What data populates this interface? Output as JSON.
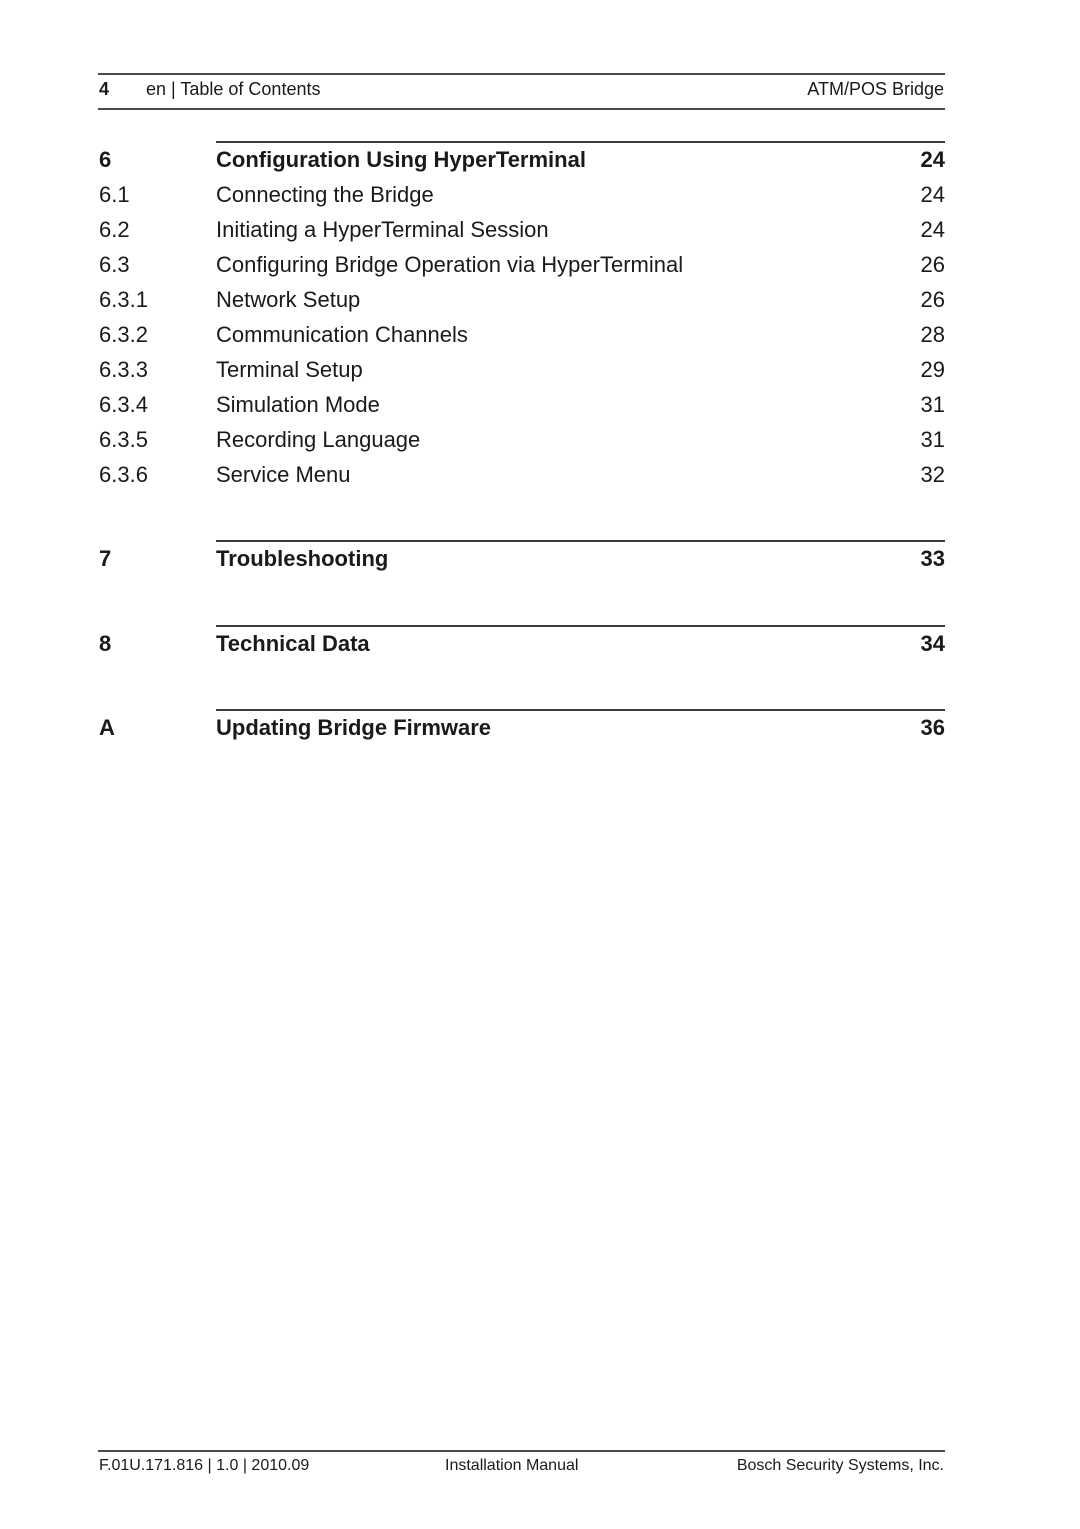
{
  "header": {
    "page_number": "4",
    "section_label": "en | Table of Contents",
    "product_name": "ATM/POS Bridge"
  },
  "toc": {
    "entries": [
      {
        "number": "6",
        "title": "Configuration Using HyperTerminal",
        "page": "24",
        "level": "chapter"
      },
      {
        "number": "6.1",
        "title": "Connecting the Bridge",
        "page": "24",
        "level": "section"
      },
      {
        "number": "6.2",
        "title": "Initiating a HyperTerminal Session",
        "page": "24",
        "level": "section"
      },
      {
        "number": "6.3",
        "title": "Configuring Bridge Operation via HyperTerminal",
        "page": "26",
        "level": "section"
      },
      {
        "number": "6.3.1",
        "title": "Network Setup",
        "page": "26",
        "level": "subsection"
      },
      {
        "number": "6.3.2",
        "title": "Communication Channels",
        "page": "28",
        "level": "subsection"
      },
      {
        "number": "6.3.3",
        "title": "Terminal Setup",
        "page": "29",
        "level": "subsection"
      },
      {
        "number": "6.3.4",
        "title": "Simulation Mode",
        "page": "31",
        "level": "subsection"
      },
      {
        "number": "6.3.5",
        "title": "Recording Language",
        "page": "31",
        "level": "subsection"
      },
      {
        "number": "6.3.6",
        "title": "Service Menu",
        "page": "32",
        "level": "subsection"
      },
      {
        "number": "7",
        "title": "Troubleshooting",
        "page": "33",
        "level": "chapter"
      },
      {
        "number": "8",
        "title": "Technical Data",
        "page": "34",
        "level": "chapter"
      },
      {
        "number": "A",
        "title": "Updating Bridge Firmware",
        "page": "36",
        "level": "chapter"
      }
    ]
  },
  "footer": {
    "document_id": "F.01U.171.816 | 1.0 | 2010.09",
    "document_type": "Installation Manual",
    "company": "Bosch Security Systems, Inc."
  }
}
